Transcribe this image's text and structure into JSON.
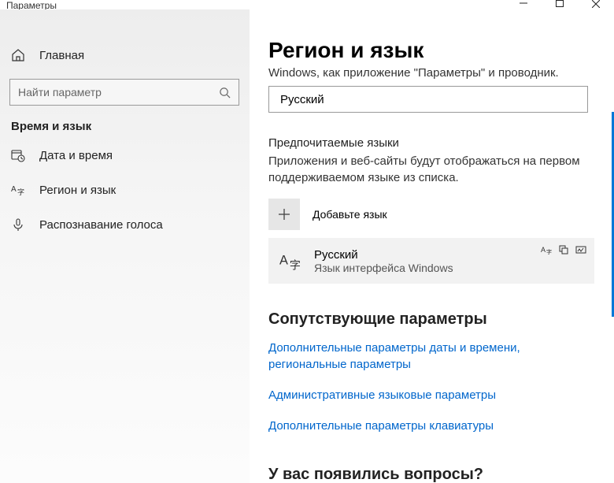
{
  "window": {
    "app_title": "Параметры"
  },
  "sidebar": {
    "home_label": "Главная",
    "search_placeholder": "Найти параметр",
    "category_header": "Время и язык",
    "items": [
      {
        "label": "Дата и время"
      },
      {
        "label": "Регион и язык"
      },
      {
        "label": "Распознавание голоса"
      }
    ]
  },
  "content": {
    "page_title": "Регион и язык",
    "display_lang_desc": "Windows, как приложение \"Параметры\" и проводник.",
    "display_lang_value": "Русский",
    "preferred_header": "Предпочитаемые языки",
    "preferred_desc": "Приложения и веб-сайты будут отображаться на первом поддерживаемом языке из списка.",
    "add_language_label": "Добавьте язык",
    "lang_card": {
      "name": "Русский",
      "subtitle": "Язык интерфейса Windows"
    },
    "related_header": "Сопутствующие параметры",
    "links": [
      "Дополнительные параметры даты и времени, региональные параметры",
      "Административные языковые параметры",
      "Дополнительные параметры клавиатуры"
    ],
    "questions_header": "У вас появились вопросы?"
  }
}
